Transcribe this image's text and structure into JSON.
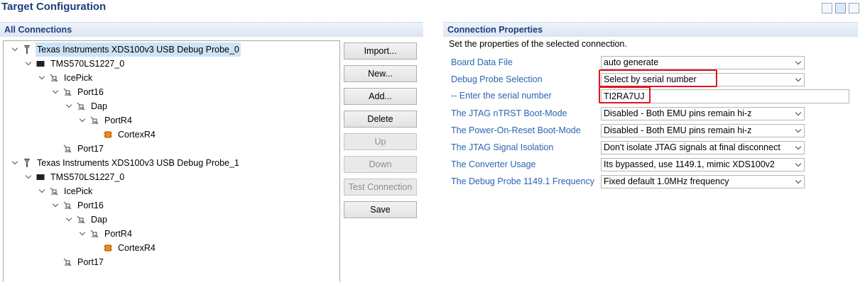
{
  "page": {
    "title": "Target Configuration"
  },
  "left": {
    "header": "All Connections",
    "tree": [
      {
        "label": "Texas Instruments XDS100v3 USB Debug Probe_0",
        "icon": "probe-icon",
        "expanded": true,
        "selected": true
      },
      {
        "label": "TMS570LS1227_0",
        "icon": "chip-icon",
        "expanded": true
      },
      {
        "label": "IcePick",
        "icon": "router-icon",
        "expanded": true
      },
      {
        "label": "Port16",
        "icon": "router-icon",
        "expanded": true
      },
      {
        "label": "Dap",
        "icon": "router-icon",
        "expanded": true
      },
      {
        "label": "PortR4",
        "icon": "router-icon",
        "expanded": true
      },
      {
        "label": "CortexR4",
        "icon": "cpu-icon",
        "expanded": false
      },
      {
        "label": "Port17",
        "icon": "router-icon",
        "expanded": false
      },
      {
        "label": "Texas Instruments XDS100v3 USB Debug Probe_1",
        "icon": "probe-icon",
        "expanded": true
      },
      {
        "label": "TMS570LS1227_0",
        "icon": "chip-icon",
        "expanded": true
      },
      {
        "label": "IcePick",
        "icon": "router-icon",
        "expanded": true
      },
      {
        "label": "Port16",
        "icon": "router-icon",
        "expanded": true
      },
      {
        "label": "Dap",
        "icon": "router-icon",
        "expanded": true
      },
      {
        "label": "PortR4",
        "icon": "router-icon",
        "expanded": true
      },
      {
        "label": "CortexR4",
        "icon": "cpu-icon",
        "expanded": false
      },
      {
        "label": "Port17",
        "icon": "router-icon",
        "expanded": false
      }
    ],
    "buttons": [
      {
        "label": "Import...",
        "enabled": true
      },
      {
        "label": "New...",
        "enabled": true
      },
      {
        "label": "Add...",
        "enabled": true
      },
      {
        "label": "Delete",
        "enabled": true
      },
      {
        "label": "Up",
        "enabled": false
      },
      {
        "label": "Down",
        "enabled": false
      },
      {
        "label": "Test Connection",
        "enabled": false
      },
      {
        "label": "Save",
        "enabled": true
      }
    ]
  },
  "right": {
    "header": "Connection Properties",
    "description": "Set the properties of the selected connection.",
    "properties": [
      {
        "label": "Board Data File",
        "value": "auto generate",
        "kind": "select"
      },
      {
        "label": "Debug Probe Selection",
        "value": "Select by serial number",
        "kind": "select",
        "highlighted": true
      },
      {
        "label": "-- Enter the serial number",
        "value": "TI2RA7UJ",
        "kind": "input",
        "highlighted": true
      },
      {
        "label": "The JTAG nTRST Boot-Mode",
        "value": "Disabled - Both EMU pins remain hi-z",
        "kind": "select"
      },
      {
        "label": "The Power-On-Reset Boot-Mode",
        "value": "Disabled - Both EMU pins remain hi-z",
        "kind": "select"
      },
      {
        "label": "The JTAG Signal Isolation",
        "value": "Don't isolate JTAG signals at final disconnect",
        "kind": "select"
      },
      {
        "label": "The Converter Usage",
        "value": "Its bypassed, use 1149.1, mimic XDS100v2",
        "kind": "select"
      },
      {
        "label": "The Debug Probe 1149.1 Frequency",
        "value": "Fixed default 1.0MHz frequency",
        "kind": "select"
      }
    ]
  },
  "colors": {
    "title": "#1c3f7a",
    "link": "#2a65b0",
    "highlight": "#e0141e",
    "selection": "#cde3f7"
  }
}
